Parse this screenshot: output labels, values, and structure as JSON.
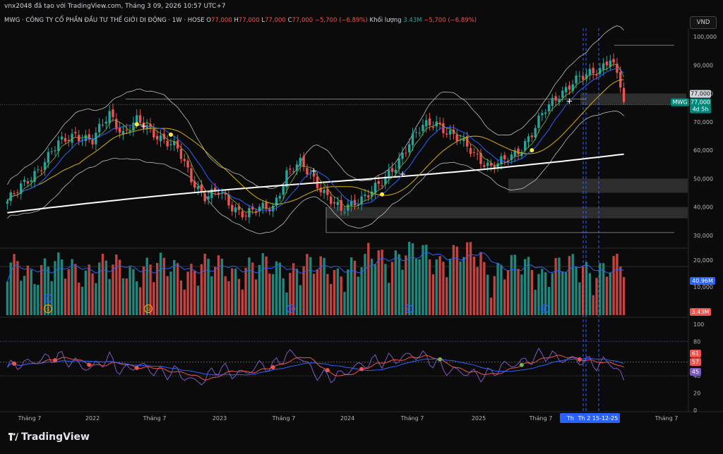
{
  "header": {
    "created_by": "vnx2048 đã tạo với TradingView.com, Tháng 3 09, 2026 10:57 UTC+7"
  },
  "legend": {
    "title": "MWG · CÔNG TY CỔ PHẦN ĐẦU TƯ THẾ GIỚI DI ĐỘNG · 1W · HOSE",
    "o_label": "O",
    "o": "77,000",
    "h_label": "H",
    "h": "77,000",
    "l_label": "L",
    "l": "77,000",
    "c_label": "C",
    "c": "77,000",
    "change": "−5,700 (−6.89%)",
    "vol_label": "Khối lượng",
    "vol": "3.43M",
    "vol_change": "−5,700 (−6.89%)"
  },
  "currency": "VND",
  "price_axis": [
    "100,000",
    "90,000",
    "80,000",
    "70,000",
    "60,000",
    "50,000",
    "40,000",
    "30,000"
  ],
  "volume_axis": [
    "20,000",
    "10,000"
  ],
  "rsi_axis": [
    "100",
    "80",
    "60",
    "40",
    "20",
    "0"
  ],
  "time_axis": [
    "Tháng 7",
    "2022",
    "Tháng 7",
    "2023",
    "Tháng 7",
    "2024",
    "Tháng 7",
    "2025",
    "Tháng 7",
    "Th",
    "Th 2 15-12-25",
    "Tháng 7"
  ],
  "badges": {
    "last_price": "77,000",
    "symbol": "MWG",
    "symbol_price": "77,000",
    "countdown": "4d 5h",
    "volume_ma": "40.96M",
    "volume": "3.43M",
    "rsi_1": "61",
    "rsi_2": "57",
    "rsi_3": "45"
  },
  "markers": {
    "dividend": "D",
    "split": "S"
  },
  "brand": "TradingView",
  "colors": {
    "up": "#26a69a",
    "down": "#ef5350",
    "ma_fast": "#2962ff",
    "ma_mid": "#7cb342",
    "ma_slow": "#d4b106",
    "ma_long": "#ffffff",
    "rsi": "#7e57c2",
    "highlight": "#2962ff"
  },
  "chart_data": {
    "type": "candlestick",
    "timeframe": "1W",
    "symbol": "MWG",
    "ylim": [
      27000,
      103000
    ],
    "x_labels": [
      "Tháng 7",
      "2022",
      "Tháng 7",
      "2023",
      "Tháng 7",
      "2024",
      "Tháng 7",
      "2025",
      "Tháng 7"
    ],
    "price_anchors": [
      [
        0,
        42000
      ],
      [
        5,
        48000
      ],
      [
        10,
        55000
      ],
      [
        15,
        62000
      ],
      [
        20,
        66000
      ],
      [
        25,
        63000
      ],
      [
        30,
        73000
      ],
      [
        34,
        66000
      ],
      [
        38,
        70000
      ],
      [
        42,
        67000
      ],
      [
        46,
        64000
      ],
      [
        50,
        60000
      ],
      [
        54,
        50000
      ],
      [
        58,
        44000
      ],
      [
        62,
        45000
      ],
      [
        66,
        40000
      ],
      [
        70,
        38000
      ],
      [
        74,
        39000
      ],
      [
        78,
        40000
      ],
      [
        82,
        52000
      ],
      [
        86,
        55000
      ],
      [
        90,
        50000
      ],
      [
        94,
        44000
      ],
      [
        98,
        38000
      ],
      [
        102,
        42000
      ],
      [
        106,
        45000
      ],
      [
        110,
        48000
      ],
      [
        114,
        55000
      ],
      [
        118,
        63000
      ],
      [
        122,
        68000
      ],
      [
        126,
        70000
      ],
      [
        130,
        66000
      ],
      [
        134,
        62000
      ],
      [
        138,
        58000
      ],
      [
        142,
        54000
      ],
      [
        146,
        56000
      ],
      [
        150,
        60000
      ],
      [
        154,
        66000
      ],
      [
        158,
        74000
      ],
      [
        162,
        80000
      ],
      [
        166,
        84000
      ],
      [
        170,
        86000
      ],
      [
        174,
        89000
      ],
      [
        177,
        93000
      ],
      [
        180,
        82700
      ],
      [
        181,
        77000
      ]
    ],
    "last": {
      "open": 77000,
      "high": 77000,
      "low": 77000,
      "close": 77000,
      "change": -5700,
      "change_pct": -6.89
    },
    "volume_last": "3.43M",
    "volume_ma": "40.96M",
    "rsi": {
      "ylim": [
        0,
        100
      ],
      "levels": [
        80,
        20
      ],
      "last": [
        61,
        57,
        45
      ]
    },
    "zones": [
      {
        "from": 50000,
        "to": 45000
      },
      {
        "from": 40000,
        "to": 36000
      },
      {
        "from": 80000,
        "to": 76000
      }
    ]
  }
}
